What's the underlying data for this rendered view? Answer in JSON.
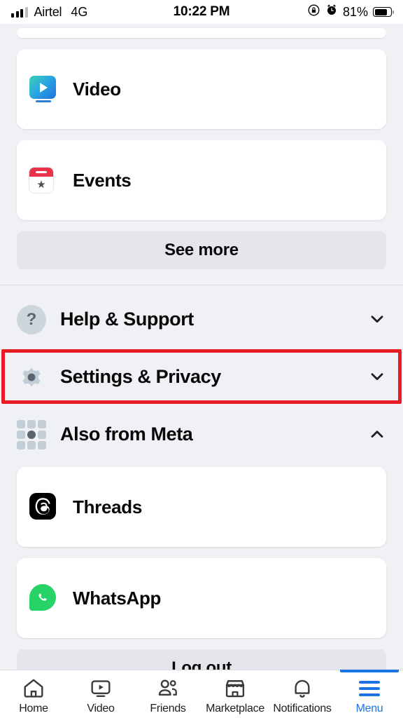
{
  "status_bar": {
    "carrier": "Airtel",
    "network": "4G",
    "time": "10:22 PM",
    "battery_percent": "81%",
    "icons": [
      "signal-bars-icon",
      "rotation-lock-icon",
      "alarm-clock-icon",
      "battery-icon"
    ]
  },
  "menu": {
    "shortcut_cards": [
      {
        "label": "Video",
        "icon": "video-icon"
      },
      {
        "label": "Events",
        "icon": "events-calendar-icon"
      }
    ],
    "see_more_label": "See more",
    "sections": [
      {
        "label": "Help & Support",
        "icon": "help-question-icon",
        "chevron": "chevron-down-icon",
        "expanded": false,
        "highlighted": false
      },
      {
        "label": "Settings & Privacy",
        "icon": "gear-icon",
        "chevron": "chevron-down-icon",
        "expanded": false,
        "highlighted": true
      },
      {
        "label": "Also from Meta",
        "icon": "grid-apps-icon",
        "chevron": "chevron-up-icon",
        "expanded": true,
        "highlighted": false
      }
    ],
    "meta_apps": [
      {
        "label": "Threads",
        "icon": "threads-icon"
      },
      {
        "label": "WhatsApp",
        "icon": "whatsapp-icon"
      }
    ],
    "log_out_label": "Log out"
  },
  "tabbar": {
    "active": "Menu",
    "tabs": [
      {
        "label": "Home",
        "icon": "home-icon"
      },
      {
        "label": "Video",
        "icon": "video-player-icon"
      },
      {
        "label": "Friends",
        "icon": "friends-icon"
      },
      {
        "label": "Marketplace",
        "icon": "marketplace-store-icon"
      },
      {
        "label": "Notifications",
        "icon": "bell-icon"
      },
      {
        "label": "Menu",
        "icon": "hamburger-menu-icon"
      }
    ]
  },
  "colors": {
    "accent_blue": "#1b74e4",
    "highlight_red": "#e81c24",
    "page_background": "#eff1f5",
    "card_background": "#ffffff",
    "pill_background": "#e4e6eb"
  }
}
